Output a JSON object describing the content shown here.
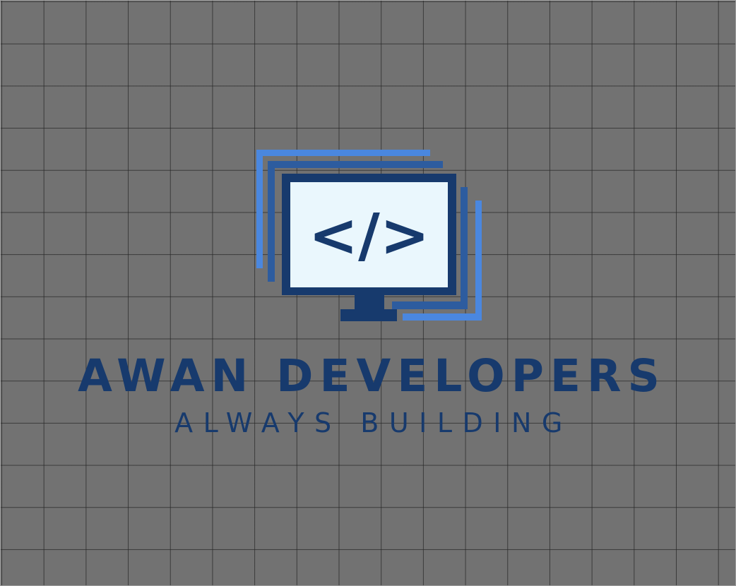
{
  "logo": {
    "icon": "monitor-code-icon",
    "code_symbol": "</>",
    "brand_name": "AWAN DEVELOPERS",
    "tagline": "ALWAYS BUILDING"
  },
  "colors": {
    "background": "#727272",
    "grid_line": "#3c3c3c",
    "navy": "#173a6d",
    "mid_blue": "#2d5c9f",
    "light_blue": "#4a87df",
    "screen": "#eaf7fd"
  }
}
